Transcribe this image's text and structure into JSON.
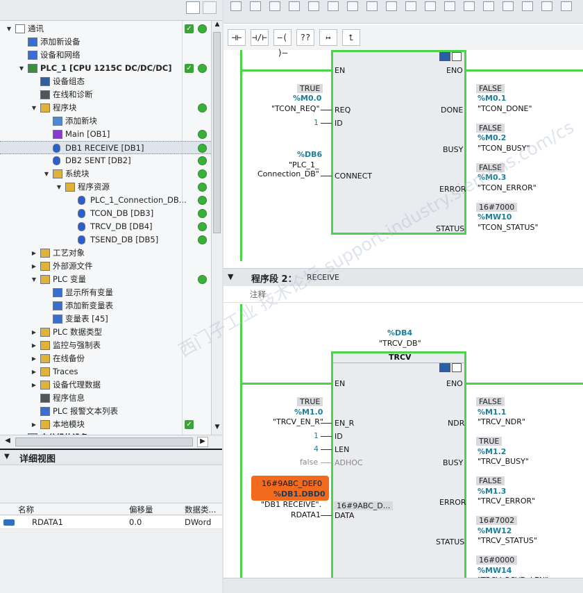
{
  "tree": [
    {
      "label": "通讯",
      "level": 0,
      "arrow": "open",
      "icon": "document-icon",
      "check": true,
      "dot": true
    },
    {
      "label": "添加新设备",
      "level": 1,
      "arrow": "",
      "icon": "add-device-icon"
    },
    {
      "label": "设备和网络",
      "level": 1,
      "arrow": "",
      "icon": "network-icon"
    },
    {
      "label": "PLC_1 [CPU 1215C DC/DC/DC]",
      "level": 1,
      "arrow": "open",
      "icon": "plc-icon",
      "bold": true,
      "check": true,
      "dot": true
    },
    {
      "label": "设备组态",
      "level": 2,
      "arrow": "",
      "icon": "device-config-icon"
    },
    {
      "label": "在线和诊断",
      "level": 2,
      "arrow": "",
      "icon": "diagnostics-icon"
    },
    {
      "label": "程序块",
      "level": 2,
      "arrow": "open",
      "icon": "folder-icon",
      "dot": true
    },
    {
      "label": "添加新块",
      "level": 3,
      "arrow": "",
      "icon": "add-block-icon"
    },
    {
      "label": "Main [OB1]",
      "level": 3,
      "arrow": "",
      "icon": "ob-icon",
      "dot": true
    },
    {
      "label": "DB1 RECEIVE [DB1]",
      "level": 3,
      "arrow": "",
      "icon": "db-icon",
      "dot": true,
      "selected": true
    },
    {
      "label": "DB2 SENT [DB2]",
      "level": 3,
      "arrow": "",
      "icon": "db-icon",
      "dot": true
    },
    {
      "label": "系统块",
      "level": 3,
      "arrow": "open",
      "icon": "folder-icon",
      "dot": true
    },
    {
      "label": "程序资源",
      "level": 4,
      "arrow": "open",
      "icon": "folder-icon",
      "dot": true
    },
    {
      "label": "PLC_1_Connection_DB...",
      "level": 5,
      "arrow": "",
      "icon": "db-icon",
      "dot": true
    },
    {
      "label": "TCON_DB [DB3]",
      "level": 5,
      "arrow": "",
      "icon": "db-lock-icon",
      "dot": true
    },
    {
      "label": "TRCV_DB [DB4]",
      "level": 5,
      "arrow": "",
      "icon": "db-lock-icon",
      "dot": true
    },
    {
      "label": "TSEND_DB [DB5]",
      "level": 5,
      "arrow": "",
      "icon": "db-lock-icon",
      "dot": true
    },
    {
      "label": "工艺对象",
      "level": 2,
      "arrow": "closed",
      "icon": "folder-icon"
    },
    {
      "label": "外部源文件",
      "level": 2,
      "arrow": "closed",
      "icon": "folder-icon"
    },
    {
      "label": "PLC 变量",
      "level": 2,
      "arrow": "open",
      "icon": "folder-icon",
      "dot": true
    },
    {
      "label": "显示所有变量",
      "level": 3,
      "arrow": "",
      "icon": "tags-icon"
    },
    {
      "label": "添加新变量表",
      "level": 3,
      "arrow": "",
      "icon": "add-table-icon"
    },
    {
      "label": "变量表 [45]",
      "level": 3,
      "arrow": "",
      "icon": "tag-table-icon"
    },
    {
      "label": "PLC 数据类型",
      "level": 2,
      "arrow": "closed",
      "icon": "folder-icon"
    },
    {
      "label": "监控与强制表",
      "level": 2,
      "arrow": "closed",
      "icon": "folder-icon"
    },
    {
      "label": "在线备份",
      "level": 2,
      "arrow": "closed",
      "icon": "folder-icon"
    },
    {
      "label": "Traces",
      "level": 2,
      "arrow": "closed",
      "icon": "folder-icon"
    },
    {
      "label": "设备代理数据",
      "level": 2,
      "arrow": "closed",
      "icon": "folder-icon"
    },
    {
      "label": "程序信息",
      "level": 2,
      "arrow": "",
      "icon": "info-icon"
    },
    {
      "label": "PLC 报警文本列表",
      "level": 2,
      "arrow": "",
      "icon": "alarm-text-icon"
    },
    {
      "label": "本地模块",
      "level": 2,
      "arrow": "closed",
      "icon": "folder-icon",
      "check": true
    },
    {
      "label": "未分组的设备",
      "level": 1,
      "arrow": "closed",
      "icon": "folder-icon",
      "bold": true
    }
  ],
  "detail": {
    "title": "详细视图",
    "headers": [
      "名称",
      "偏移量",
      "数据类..."
    ],
    "row": {
      "name": "RDATA1",
      "offset": "0.0",
      "type": "DWord"
    }
  },
  "ladder_tools": [
    "⊣⊢",
    "⊣/⊢",
    "–( )–",
    "??",
    "↦",
    "⮤"
  ],
  "net1": {
    "pins_left": [
      "EN",
      "REQ",
      "ID",
      "CONNECT"
    ],
    "pins_right": [
      "ENO",
      "DONE",
      "BUSY",
      "ERROR",
      "STATUS"
    ],
    "req_val": "TRUE",
    "req_adr": "%M0.0",
    "req_tag": "\"TCON_REQ\"",
    "id_val": "1",
    "conn_adr": "%DB6",
    "conn_tag1": "\"PLC_1_",
    "conn_tag2": "Connection_DB\"",
    "done_val": "FALSE",
    "done_adr": "%M0.1",
    "done_tag": "\"TCON_DONE\"",
    "busy_val": "FALSE",
    "busy_adr": "%M0.2",
    "busy_tag": "\"TCON_BUSY\"",
    "err_val": "FALSE",
    "err_adr": "%M0.3",
    "err_tag": "\"TCON_ERROR\"",
    "stat_val": "16#7000",
    "stat_adr": "%MW10",
    "stat_tag": "\"TCON_STATUS\""
  },
  "net2": {
    "header": "程序段 2：",
    "name": "RECEIVE",
    "comment": "注释",
    "inst_adr": "%DB4",
    "inst_tag": "\"TRCV_DB\"",
    "block_title": "TRCV",
    "pins_left": [
      "EN",
      "EN_R",
      "ID",
      "LEN",
      "ADHOC",
      "DATA"
    ],
    "pins_right": [
      "ENO",
      "NDR",
      "BUSY",
      "ERROR",
      "STATUS"
    ],
    "enr_val": "TRUE",
    "enr_adr": "%M1.0",
    "enr_tag": "\"TRCV_EN_R\"",
    "id_val": "1",
    "len_val": "4",
    "adhoc_val": "false",
    "data_val": "16#9ABC_DEF0",
    "data_adr": "%DB1.DBD0",
    "data_tag1": "\"DB1 RECEIVE\".",
    "data_tag2": "RDATA1",
    "data_inside": "16#9ABC_D...",
    "ndr_val": "FALSE",
    "ndr_adr": "%M1.1",
    "ndr_tag": "\"TRCV_NDR\"",
    "busy_val": "TRUE",
    "busy_adr": "%M1.2",
    "busy_tag": "\"TRCV_BUSY\"",
    "err_val": "FALSE",
    "err_adr": "%M1.3",
    "err_tag": "\"TRCV_ERROR\"",
    "stat_val": "16#7002",
    "stat_adr": "%MW12",
    "stat_tag": "\"TRCV_STATUS\"",
    "rcvd_val": "16#0000",
    "rcvd_adr": "%MW14",
    "rcvd_tag": "\"TRCV_RCVD_LEN\""
  },
  "watermark": "西门子工业 技术论坛 support.industry.siemens.com/cs",
  "colors": {
    "rail": "#49d449",
    "address": "#1a7f9c",
    "highlight": "#f26a1b"
  }
}
